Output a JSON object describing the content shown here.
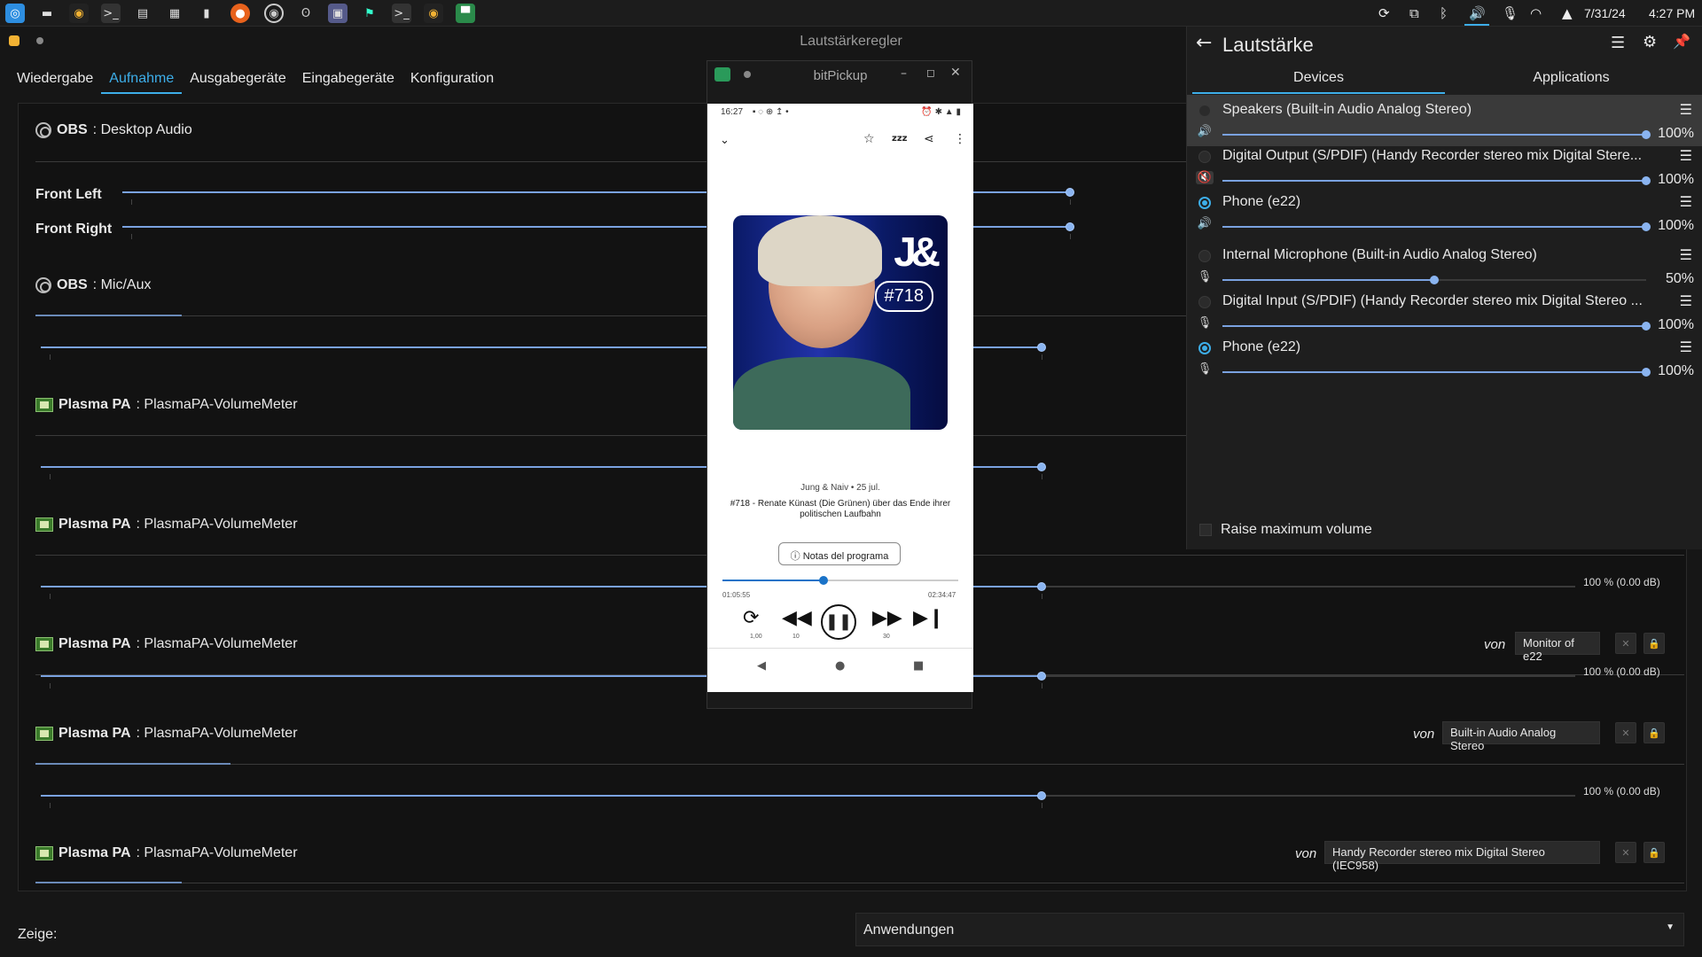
{
  "taskbar": {
    "date": "7/31/24",
    "time": "4:27 PM"
  },
  "mixer": {
    "window_title": "Lautstärkeregler",
    "tabs": [
      "Wiedergabe",
      "Aufnahme",
      "Ausgabegeräte",
      "Eingabegeräte",
      "Konfiguration"
    ],
    "active_tab": "Aufnahme",
    "streams": [
      {
        "app": "OBS",
        "name": ": Desktop Audio",
        "icon": "obs-icon"
      },
      {
        "app": "OBS",
        "name": ": Mic/Aux",
        "icon": "obs-icon"
      },
      {
        "app": "Plasma PA",
        "name": ": PlasmaPA-VolumeMeter",
        "icon": "plasma-pa-icon"
      },
      {
        "app": "Plasma PA",
        "name": ": PlasmaPA-VolumeMeter",
        "icon": "plasma-pa-icon"
      },
      {
        "app": "Plasma PA",
        "name": ": PlasmaPA-VolumeMeter",
        "icon": "plasma-pa-icon"
      },
      {
        "app": "Plasma PA",
        "name": ": PlasmaPA-VolumeMeter",
        "icon": "plasma-pa-icon"
      },
      {
        "app": "Plasma PA",
        "name": ": PlasmaPA-VolumeMeter",
        "icon": "plasma-pa-icon"
      }
    ],
    "channels": {
      "front_left": "Front Left",
      "front_right": "Front Right"
    },
    "db_readout": "100 % (0.00 dB)",
    "von": "von",
    "source_devices": [
      "Monitor of e22",
      "Built-in Audio Analog Stereo",
      "Handy Recorder stereo mix Digital Stereo (IEC958)"
    ],
    "show_label": "Zeige:",
    "show_value": "Anwendungen"
  },
  "phone": {
    "window_title": "bitPickup",
    "status_time": "16:27",
    "podcast": "Jung & Naiv",
    "date": "25 jul.",
    "episode_title": "#718 - Renate Künast (Die Grünen) über das Ende ihrer politischen Laufbahn",
    "episode_badge": "#718",
    "logo_text": "J&",
    "notes_button": "Notas del programa",
    "time_elapsed": "01:05:55",
    "time_total": "02:34:47",
    "progress": 0.43,
    "speed": "1,00",
    "rewind": "10",
    "forward": "30"
  },
  "volume_popup": {
    "title": "Lautstärke",
    "tabs": [
      "Devices",
      "Applications"
    ],
    "active_tab": "Devices",
    "devices": [
      {
        "name": "Speakers (Built-in Audio Analog Stereo)",
        "percent": "100%",
        "level": 1.0,
        "type": "output",
        "default": false,
        "muted": false,
        "highlight": true
      },
      {
        "name": "Digital Output (S/PDIF) (Handy Recorder stereo mix Digital Stere...",
        "percent": "100%",
        "level": 1.0,
        "type": "output",
        "default": false,
        "muted": true,
        "highlight": false
      },
      {
        "name": "Phone (e22)",
        "percent": "100%",
        "level": 1.0,
        "type": "output",
        "default": true,
        "muted": false,
        "highlight": false
      },
      {
        "name": "Internal Microphone (Built-in Audio Analog Stereo)",
        "percent": "50%",
        "level": 0.5,
        "type": "input",
        "default": false,
        "muted": false,
        "highlight": false
      },
      {
        "name": "Digital Input (S/PDIF) (Handy Recorder stereo mix Digital Stereo ...",
        "percent": "100%",
        "level": 1.0,
        "type": "input",
        "default": false,
        "muted": false,
        "highlight": false
      },
      {
        "name": "Phone (e22)",
        "percent": "100%",
        "level": 1.0,
        "type": "input",
        "default": true,
        "muted": false,
        "highlight": false
      }
    ],
    "raise_max": "Raise maximum volume"
  },
  "colors": {
    "accent": "#3daee9",
    "slider": "#7aa2e0"
  }
}
